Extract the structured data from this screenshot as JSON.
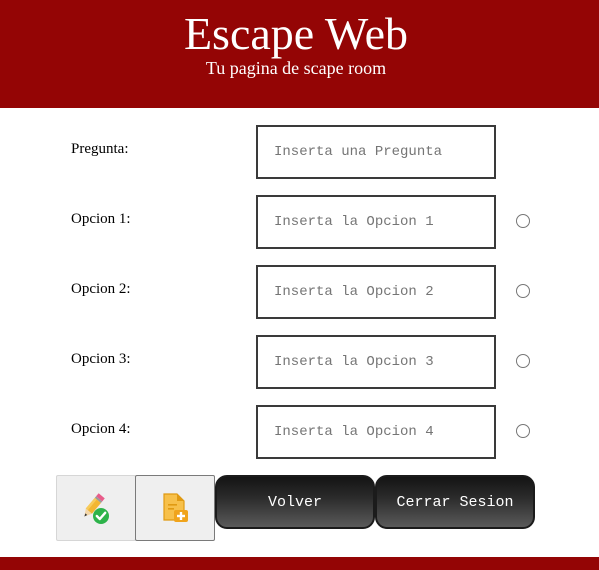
{
  "header": {
    "title": "Escape Web",
    "subtitle": "Tu pagina de scape room"
  },
  "form": {
    "question": {
      "label": "Pregunta:",
      "placeholder": "Inserta una Pregunta",
      "value": ""
    },
    "options": [
      {
        "label": "Opcion 1:",
        "placeholder": "Inserta la Opcion 1",
        "value": "",
        "selected": false
      },
      {
        "label": "Opcion 2:",
        "placeholder": "Inserta la Opcion 2",
        "value": "",
        "selected": false
      },
      {
        "label": "Opcion 3:",
        "placeholder": "Inserta la Opcion 3",
        "value": "",
        "selected": false
      },
      {
        "label": "Opcion 4:",
        "placeholder": "Inserta la Opcion 4",
        "value": "",
        "selected": false
      }
    ]
  },
  "actions": {
    "edit_icon": "pencil-check-icon",
    "add_icon": "file-plus-icon",
    "back_label": "Volver",
    "logout_label": "Cerrar Sesion"
  },
  "colors": {
    "brand_red": "#940505",
    "check_green": "#2db34a",
    "doc_orange": "#f0a41c"
  }
}
